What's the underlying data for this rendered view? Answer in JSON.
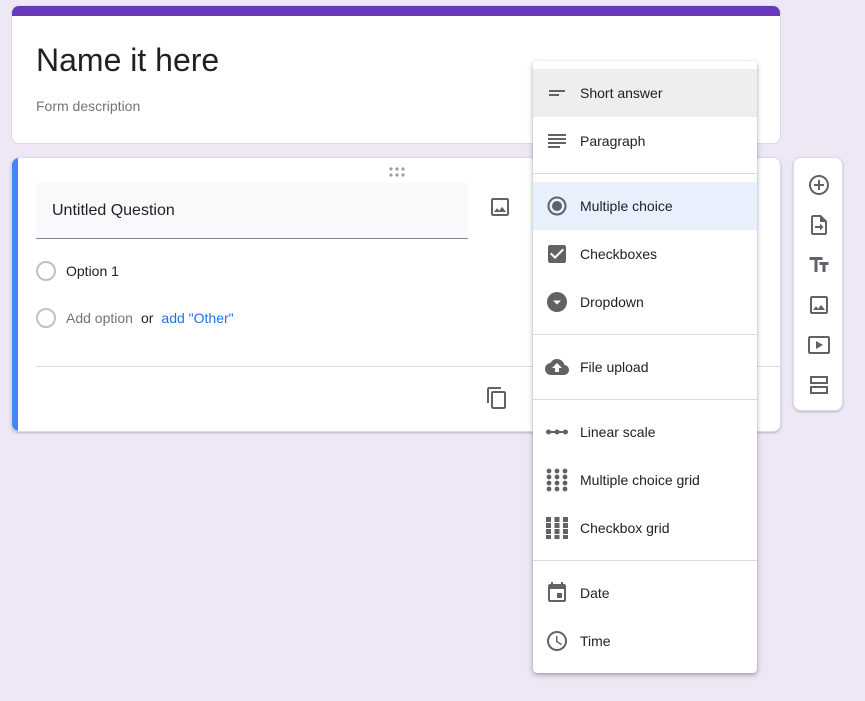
{
  "form": {
    "title": "Name it here",
    "description": "Form description"
  },
  "question": {
    "title": "Untitled Question",
    "options": [
      "Option 1"
    ],
    "add_option_label": "Add option",
    "or_label": "or",
    "add_other_label": "add \"Other\""
  },
  "type_menu": {
    "items": [
      {
        "label": "Short answer",
        "icon": "short-answer-icon"
      },
      {
        "label": "Paragraph",
        "icon": "paragraph-icon"
      },
      {
        "label": "Multiple choice",
        "icon": "radio-icon"
      },
      {
        "label": "Checkboxes",
        "icon": "checkbox-icon"
      },
      {
        "label": "Dropdown",
        "icon": "dropdown-icon"
      },
      {
        "label": "File upload",
        "icon": "cloud-upload-icon"
      },
      {
        "label": "Linear scale",
        "icon": "linear-scale-icon"
      },
      {
        "label": "Multiple choice grid",
        "icon": "dot-grid-icon"
      },
      {
        "label": "Checkbox grid",
        "icon": "square-grid-icon"
      },
      {
        "label": "Date",
        "icon": "calendar-icon"
      },
      {
        "label": "Time",
        "icon": "clock-icon"
      }
    ],
    "selected": "Multiple choice",
    "hovered": "Short answer"
  },
  "side_toolbar": {
    "icons": [
      "add-question-icon",
      "import-questions-icon",
      "add-title-icon",
      "add-image-icon",
      "add-video-icon",
      "add-section-icon"
    ]
  },
  "colors": {
    "theme": "#673ab7",
    "background": "#ede7f6",
    "active_bar": "#4285f4",
    "link": "#1a73e8",
    "selected_item": "#e8f0fe"
  }
}
